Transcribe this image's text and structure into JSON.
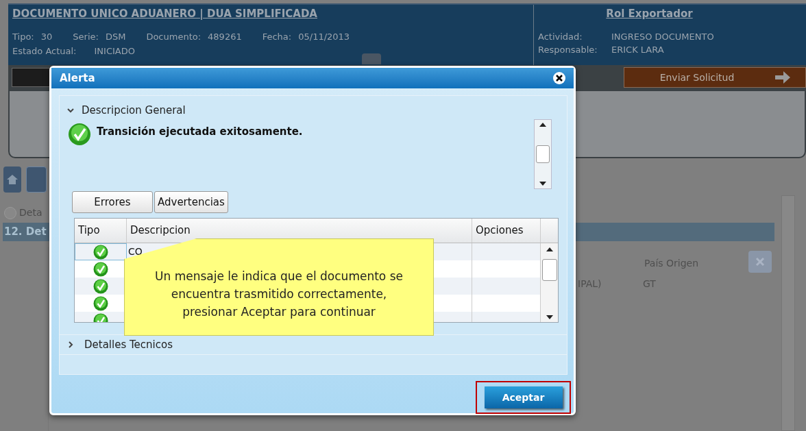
{
  "header": {
    "title": "DOCUMENTO UNICO ADUANERO | DUA SIMPLIFICADA",
    "fields": [
      {
        "label": "Tipo:",
        "value": "30"
      },
      {
        "label": "Serie:",
        "value": "DSM"
      },
      {
        "label": "Documento:",
        "value": "489261"
      },
      {
        "label": "Fecha:",
        "value": "05/11/2013"
      }
    ],
    "status": {
      "label": "Estado Actual:",
      "value": "INICIADO"
    },
    "role": {
      "title": "Rol Exportador",
      "fields": [
        {
          "label": "Actividad:",
          "value": "INGRESO DOCUMENTO"
        },
        {
          "label": "Responsable:",
          "value": "ERICK LARA"
        }
      ]
    }
  },
  "toolbar": {
    "send_button": "Enviar Solicitud"
  },
  "section": {
    "toggle_label": "Deta",
    "band_title": "12. Det"
  },
  "grid": {
    "columns": [
      "País Origen"
    ],
    "row": [
      "IPAL)",
      "GT"
    ]
  },
  "dialog": {
    "title": "Alerta",
    "general": {
      "label": "Descripcion General",
      "expanded": true
    },
    "message": "Transición ejecutada exitosamente.",
    "tabs": [
      {
        "label": "Errores",
        "selected": false
      },
      {
        "label": "Advertencias",
        "selected": false
      }
    ],
    "table": {
      "columns": [
        "Tipo",
        "Descripcion",
        "Opciones"
      ],
      "rows": [
        {
          "kind": "success",
          "description": "CO",
          "selected": true
        },
        {
          "kind": "success",
          "selected": false
        },
        {
          "kind": "success",
          "selected": false
        },
        {
          "kind": "success",
          "selected": false
        },
        {
          "kind": "success",
          "selected": false
        }
      ]
    },
    "technical": {
      "label": "Detalles Tecnicos",
      "expanded": false
    },
    "callout": "Un mensaje le indica que el documento se encuentra trasmitido correctamente, presionar Aceptar para continuar",
    "accept_button": "Aceptar"
  }
}
